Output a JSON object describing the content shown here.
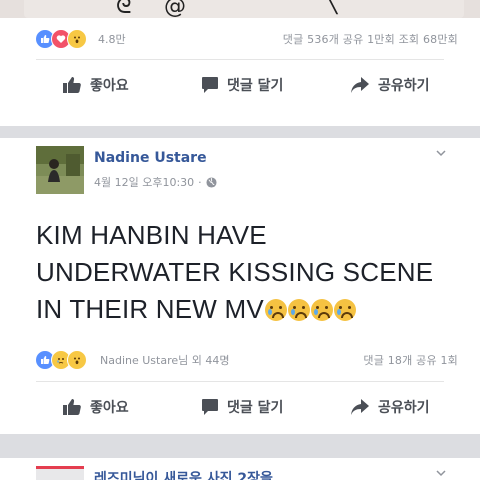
{
  "prev_post": {
    "reaction_count": "4.8만",
    "stats": "댓글 536개 공유 1만회 조회 68만회"
  },
  "actions": {
    "like": "좋아요",
    "comment": "댓글 달기",
    "share": "공유하기"
  },
  "post": {
    "author": "Nadine Ustare",
    "timestamp": "4월 12일 오후10:30",
    "privacy_separator": "·",
    "text_lines": [
      "KIM HANBIN HAVE",
      "UNDERWATER KISSING SCENE",
      "IN THEIR NEW MV"
    ],
    "reaction_summary": "Nadine Ustare님 외 44명",
    "stats": "댓글 18개 공유 1회"
  },
  "next_post": {
    "author_partial": "레즈미님이 새로운 사진 2장을"
  },
  "icons": {
    "like": "thumbs-up-icon",
    "comment": "speech-bubble-icon",
    "share": "share-arrow-icon",
    "globe": "globe-icon",
    "menu": "chevron-down-icon"
  },
  "colors": {
    "link_blue": "#365899",
    "like_blue": "#5890ff",
    "love_red": "#f25268",
    "meta_gray": "#90949c"
  }
}
